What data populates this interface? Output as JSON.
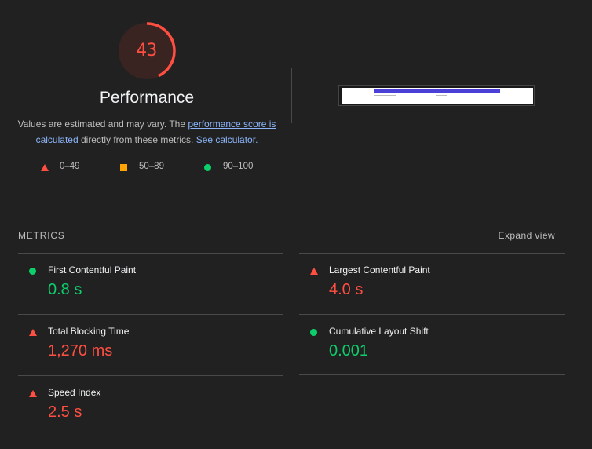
{
  "score": {
    "value": "43",
    "fraction": 0.43,
    "color": "#ff4e42",
    "track_color": "#3a2422"
  },
  "category": {
    "title": "Performance"
  },
  "description": {
    "text_1": "Values are estimated and may vary. The ",
    "link_score": "performance score is calculated",
    "text_2": " directly from these metrics. ",
    "link_calculator": "See calculator."
  },
  "legend": [
    {
      "label": "0–49",
      "shape": "triangle-icon",
      "color": "#ff4e42"
    },
    {
      "label": "50–89",
      "shape": "square-icon",
      "color": "#ffa400"
    },
    {
      "label": "90–100",
      "shape": "circle-icon",
      "color": "#0cce6b"
    }
  ],
  "metrics_section": {
    "header": "METRICS",
    "expand_label": "Expand view"
  },
  "metrics": [
    {
      "title": "First Contentful Paint",
      "value": "0.8 s",
      "status": "pass",
      "icon": "circle-icon"
    },
    {
      "title": "Largest Contentful Paint",
      "value": "4.0 s",
      "status": "fail",
      "icon": "triangle-icon"
    },
    {
      "title": "Total Blocking Time",
      "value": "1,270 ms",
      "status": "fail",
      "icon": "triangle-icon"
    },
    {
      "title": "Cumulative Layout Shift",
      "value": "0.001",
      "status": "pass",
      "icon": "circle-icon"
    },
    {
      "title": "Speed Index",
      "value": "2.5 s",
      "status": "fail",
      "icon": "triangle-icon"
    }
  ],
  "colors": {
    "fail": "#ff4e42",
    "average": "#ffa400",
    "pass": "#0cce6b",
    "link": "#8ab4f8",
    "background": "#212121"
  }
}
